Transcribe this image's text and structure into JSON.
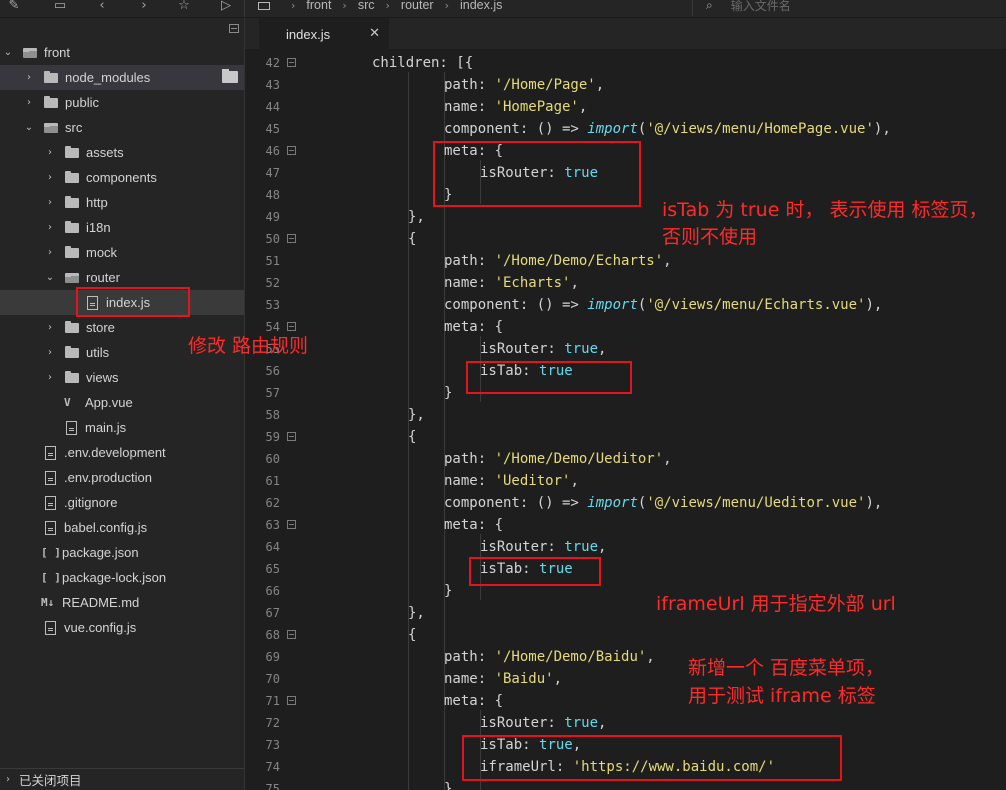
{
  "breadcrumb": [
    "front",
    "src",
    "router",
    "index.js"
  ],
  "search": {
    "placeholder": "输入文件名"
  },
  "sidebar": {
    "items": [
      {
        "label": "front",
        "kind": "root"
      },
      {
        "label": "node_modules",
        "kind": "folder"
      },
      {
        "label": "public",
        "kind": "folder"
      },
      {
        "label": "src",
        "kind": "folder-open"
      },
      {
        "label": "assets",
        "kind": "folder"
      },
      {
        "label": "components",
        "kind": "folder"
      },
      {
        "label": "http",
        "kind": "folder"
      },
      {
        "label": "i18n",
        "kind": "folder"
      },
      {
        "label": "mock",
        "kind": "folder"
      },
      {
        "label": "router",
        "kind": "folder-open"
      },
      {
        "label": "index.js",
        "kind": "file"
      },
      {
        "label": "store",
        "kind": "folder"
      },
      {
        "label": "utils",
        "kind": "folder"
      },
      {
        "label": "views",
        "kind": "folder"
      },
      {
        "label": "App.vue",
        "kind": "vue"
      },
      {
        "label": "main.js",
        "kind": "file"
      },
      {
        "label": ".env.development",
        "kind": "file"
      },
      {
        "label": ".env.production",
        "kind": "file"
      },
      {
        "label": ".gitignore",
        "kind": "file"
      },
      {
        "label": "babel.config.js",
        "kind": "file"
      },
      {
        "label": "package.json",
        "kind": "json"
      },
      {
        "label": "package-lock.json",
        "kind": "json"
      },
      {
        "label": "README.md",
        "kind": "md"
      },
      {
        "label": "vue.config.js",
        "kind": "file"
      }
    ],
    "closed_items": "已关闭项目"
  },
  "tab": {
    "label": "index.js"
  },
  "editor": {
    "lines": [
      {
        "n": "42",
        "t": [
          [
            "p",
            "children: [{"
          ]
        ]
      },
      {
        "n": "43",
        "t": [
          [
            "p",
            "path: "
          ],
          [
            "s",
            "'/Home/Page'"
          ],
          [
            "p",
            ","
          ]
        ]
      },
      {
        "n": "44",
        "t": [
          [
            "p",
            "name: "
          ],
          [
            "s",
            "'HomePage'"
          ],
          [
            "p",
            ","
          ]
        ]
      },
      {
        "n": "45",
        "t": [
          [
            "p",
            "component: () => "
          ],
          [
            "k",
            "import"
          ],
          [
            "p",
            "("
          ],
          [
            "s",
            "'@/views/menu/HomePage.vue'"
          ],
          [
            "p",
            "),"
          ]
        ]
      },
      {
        "n": "46",
        "t": [
          [
            "p",
            "meta: {"
          ]
        ]
      },
      {
        "n": "47",
        "t": [
          [
            "p",
            "isRouter: "
          ],
          [
            "b",
            "true"
          ]
        ]
      },
      {
        "n": "48",
        "t": [
          [
            "p",
            "}"
          ]
        ]
      },
      {
        "n": "49",
        "t": [
          [
            "p",
            "},"
          ]
        ]
      },
      {
        "n": "50",
        "t": [
          [
            "p",
            "{"
          ]
        ]
      },
      {
        "n": "51",
        "t": [
          [
            "p",
            "path: "
          ],
          [
            "s",
            "'/Home/Demo/Echarts'"
          ],
          [
            "p",
            ","
          ]
        ]
      },
      {
        "n": "52",
        "t": [
          [
            "p",
            "name: "
          ],
          [
            "s",
            "'Echarts'"
          ],
          [
            "p",
            ","
          ]
        ]
      },
      {
        "n": "53",
        "t": [
          [
            "p",
            "component: () => "
          ],
          [
            "k",
            "import"
          ],
          [
            "p",
            "("
          ],
          [
            "s",
            "'@/views/menu/Echarts.vue'"
          ],
          [
            "p",
            "),"
          ]
        ]
      },
      {
        "n": "54",
        "t": [
          [
            "p",
            "meta: {"
          ]
        ]
      },
      {
        "n": "55",
        "t": [
          [
            "p",
            "isRouter: "
          ],
          [
            "b",
            "true"
          ],
          [
            "p",
            ","
          ]
        ]
      },
      {
        "n": "56",
        "t": [
          [
            "p",
            "isTab: "
          ],
          [
            "b",
            "true"
          ]
        ]
      },
      {
        "n": "57",
        "t": [
          [
            "p",
            "}"
          ]
        ]
      },
      {
        "n": "58",
        "t": [
          [
            "p",
            "},"
          ]
        ]
      },
      {
        "n": "59",
        "t": [
          [
            "p",
            "{"
          ]
        ]
      },
      {
        "n": "60",
        "t": [
          [
            "p",
            "path: "
          ],
          [
            "s",
            "'/Home/Demo/Ueditor'"
          ],
          [
            "p",
            ","
          ]
        ]
      },
      {
        "n": "61",
        "t": [
          [
            "p",
            "name: "
          ],
          [
            "s",
            "'Ueditor'"
          ],
          [
            "p",
            ","
          ]
        ]
      },
      {
        "n": "62",
        "t": [
          [
            "p",
            "component: () => "
          ],
          [
            "k",
            "import"
          ],
          [
            "p",
            "("
          ],
          [
            "s",
            "'@/views/menu/Ueditor.vue'"
          ],
          [
            "p",
            "),"
          ]
        ]
      },
      {
        "n": "63",
        "t": [
          [
            "p",
            "meta: {"
          ]
        ]
      },
      {
        "n": "64",
        "t": [
          [
            "p",
            "isRouter: "
          ],
          [
            "b",
            "true"
          ],
          [
            "p",
            ","
          ]
        ]
      },
      {
        "n": "65",
        "t": [
          [
            "p",
            "isTab: "
          ],
          [
            "b",
            "true"
          ]
        ]
      },
      {
        "n": "66",
        "t": [
          [
            "p",
            "}"
          ]
        ]
      },
      {
        "n": "67",
        "t": [
          [
            "p",
            "},"
          ]
        ]
      },
      {
        "n": "68",
        "t": [
          [
            "p",
            "{"
          ]
        ]
      },
      {
        "n": "69",
        "t": [
          [
            "p",
            "path: "
          ],
          [
            "s",
            "'/Home/Demo/Baidu'"
          ],
          [
            "p",
            ","
          ]
        ]
      },
      {
        "n": "70",
        "t": [
          [
            "p",
            "name: "
          ],
          [
            "s",
            "'Baidu'"
          ],
          [
            "p",
            ","
          ]
        ]
      },
      {
        "n": "71",
        "t": [
          [
            "p",
            "meta: {"
          ]
        ]
      },
      {
        "n": "72",
        "t": [
          [
            "p",
            "isRouter: "
          ],
          [
            "b",
            "true"
          ],
          [
            "p",
            ","
          ]
        ]
      },
      {
        "n": "73",
        "t": [
          [
            "p",
            "isTab: "
          ],
          [
            "b",
            "true"
          ],
          [
            "p",
            ","
          ]
        ]
      },
      {
        "n": "74",
        "t": [
          [
            "p",
            "iframeUrl: "
          ],
          [
            "s",
            "'https://www.baidu.com/'"
          ]
        ]
      },
      {
        "n": "75",
        "t": [
          [
            "p",
            "}"
          ]
        ]
      }
    ]
  },
  "annotations": {
    "modify_router": "修改 路由规则",
    "istab_line1": "isTab 为 true 时， 表示使用 标签页，",
    "istab_line2": "否则不使用",
    "iframeurl": "iframeUrl 用于指定外部 url",
    "baidu_line1": "新增一个 百度菜单项，",
    "baidu_line2": "用于测试 iframe 标签"
  },
  "colors": {
    "string": "#e6db74",
    "keyword": "#66d9ef",
    "annotation": "#e3141e",
    "background": "#1e1e1e"
  }
}
